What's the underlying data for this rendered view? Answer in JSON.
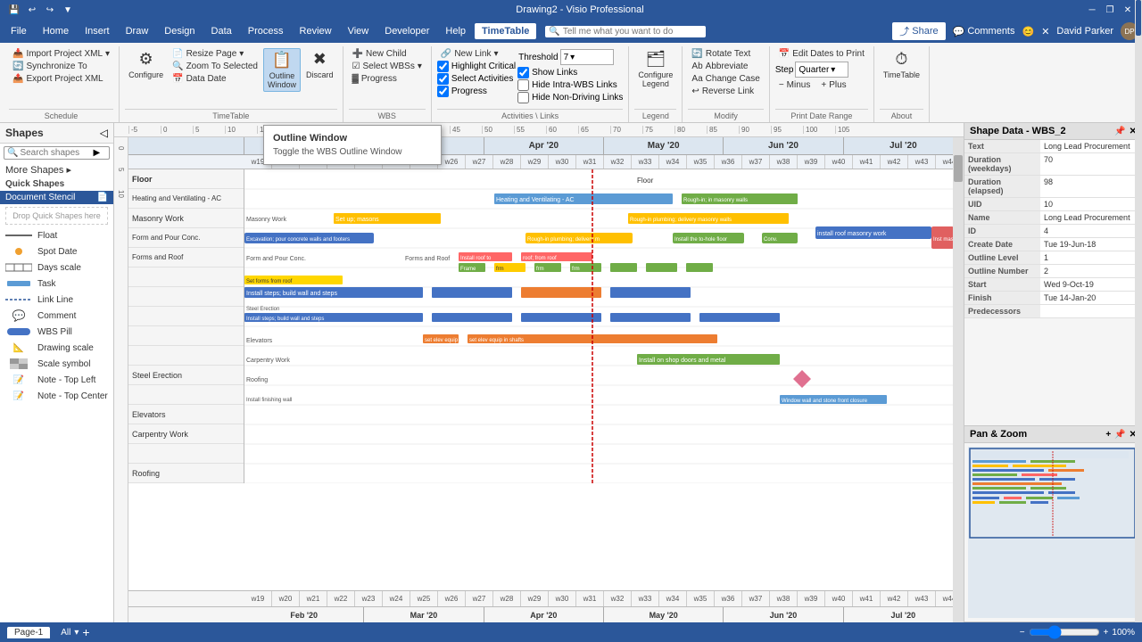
{
  "titlebar": {
    "title": "Drawing2 - Visio Professional",
    "quickaccess": [
      "save",
      "undo",
      "redo",
      "customize"
    ],
    "wincontrols": [
      "minimize",
      "restore",
      "close"
    ]
  },
  "menubar": {
    "items": [
      "File",
      "Home",
      "Insert",
      "Draw",
      "Design",
      "Data",
      "Process",
      "Review",
      "View",
      "Developer",
      "Help",
      "TimeTable"
    ],
    "active": "TimeTable",
    "search_placeholder": "Tell me what you want to do",
    "user": "David Parker",
    "share_label": "Share",
    "comments_label": "Comments"
  },
  "ribbon": {
    "groups": [
      {
        "name": "Schedule",
        "label": "Schedule",
        "items": [
          {
            "type": "btn",
            "label": "Import Project XML",
            "icon": "📥"
          },
          {
            "type": "btn",
            "label": "Synchronize To",
            "icon": "🔄"
          },
          {
            "type": "btn",
            "label": "Export Project XML",
            "icon": "📤"
          }
        ]
      },
      {
        "name": "TimeTable",
        "label": "TimeTable",
        "items": [
          {
            "type": "btn",
            "label": "Configure",
            "icon": "⚙"
          },
          {
            "type": "btn",
            "label": "Resize Page",
            "icon": "📄"
          },
          {
            "type": "btn",
            "label": "Zoom To Selected",
            "icon": "🔍"
          },
          {
            "type": "btn",
            "label": "Data Date",
            "icon": "📅"
          },
          {
            "type": "btn",
            "label": "Outline Window",
            "icon": "📋",
            "active": true
          },
          {
            "type": "btn",
            "label": "Discard",
            "icon": "✖"
          }
        ]
      },
      {
        "name": "WBS",
        "label": "WBS",
        "items": [
          {
            "type": "btn",
            "label": "New Child",
            "icon": "➕"
          },
          {
            "type": "btn",
            "label": "Select WBSs",
            "icon": "☑"
          },
          {
            "type": "btn",
            "label": "Progress",
            "icon": "📊"
          }
        ]
      },
      {
        "name": "ActivitiesLinks",
        "label": "Activities \\ Links",
        "items": [
          {
            "type": "check",
            "label": "Highlight Critical",
            "checked": true
          },
          {
            "type": "check",
            "label": "Show Links",
            "checked": true
          },
          {
            "type": "check",
            "label": "Select Activities",
            "checked": true
          },
          {
            "type": "check",
            "label": "Hide Intra-WBS Links",
            "checked": false
          },
          {
            "type": "check",
            "label": "Progress",
            "checked": true
          },
          {
            "type": "check",
            "label": "Hide Non-Driving Links",
            "checked": false
          },
          {
            "type": "btn",
            "label": "New Link",
            "icon": "🔗"
          },
          {
            "type": "combo",
            "label": "Threshold",
            "value": "7"
          }
        ]
      },
      {
        "name": "Legend",
        "label": "Legend",
        "items": [
          {
            "type": "btn",
            "label": "Configure Legend",
            "icon": "🗂"
          }
        ]
      },
      {
        "name": "Modify",
        "label": "Modify",
        "items": [
          {
            "type": "btn",
            "label": "Rotate Text",
            "icon": "🔄"
          },
          {
            "type": "btn",
            "label": "Abbreviate",
            "icon": "Ab"
          },
          {
            "type": "btn",
            "label": "Change Case",
            "icon": "Aa"
          },
          {
            "type": "btn",
            "label": "Reverse Link",
            "icon": "↩"
          }
        ]
      },
      {
        "name": "PrintDateRange",
        "label": "Print Date Range",
        "items": [
          {
            "type": "btn",
            "label": "Edit Dates to Print",
            "icon": "📅"
          },
          {
            "type": "combo",
            "label": "Step",
            "value": "Quarter"
          },
          {
            "type": "btn",
            "label": "Minus",
            "icon": "−"
          },
          {
            "type": "btn",
            "label": "Plus",
            "icon": "+"
          }
        ]
      },
      {
        "name": "About",
        "label": "About",
        "items": [
          {
            "type": "btn",
            "label": "TimeTable",
            "icon": "⏱"
          }
        ]
      }
    ]
  },
  "tooltip": {
    "title": "Outline Window",
    "description": "Toggle the WBS Outline Window"
  },
  "shapes_panel": {
    "title": "Shapes",
    "search_placeholder": "Search shapes",
    "more_shapes_label": "More Shapes",
    "quick_shapes_label": "Quick Shapes",
    "doc_stencil_label": "Document Stencil",
    "drop_zone_label": "Drop Quick Shapes here",
    "items": [
      {
        "name": "Float",
        "icon": "—"
      },
      {
        "name": "Spot Date",
        "icon": "●"
      },
      {
        "name": "Days scale",
        "icon": "≡"
      },
      {
        "name": "Task",
        "icon": "▬"
      },
      {
        "name": "Link Line",
        "icon": "—"
      },
      {
        "name": "Comment",
        "icon": "💬"
      },
      {
        "name": "WBS Pill",
        "icon": "▬"
      },
      {
        "name": "Drawing scale",
        "icon": "📐"
      },
      {
        "name": "Scale symbol",
        "icon": "▦"
      },
      {
        "name": "Note - Top Left",
        "icon": "📝"
      },
      {
        "name": "Note - Top Center",
        "icon": "📝"
      }
    ]
  },
  "gantt": {
    "months": [
      "Feb '20",
      "Mar '20",
      "Apr '20",
      "May '20",
      "Jun '20",
      "Jul '20"
    ],
    "weeks": [
      "w19",
      "w20",
      "w21",
      "w22",
      "w23",
      "w24",
      "w25",
      "w26",
      "w27",
      "w28",
      "w29",
      "w30",
      "w31",
      "w32",
      "w33",
      "w34",
      "w35",
      "w36",
      "w37",
      "w38",
      "w39",
      "w40",
      "w41",
      "w42",
      "w43",
      "w44"
    ],
    "rows": [
      {
        "label": "",
        "tasks": []
      },
      {
        "label": "Heating and Ventilating - AC",
        "tasks": [
          {
            "label": "Heating and Ventilating - AC",
            "color": "#5b9bd5",
            "start": 8,
            "width": 6
          }
        ]
      },
      {
        "label": "Masonry Work",
        "tasks": [
          {
            "label": "Masonry Work",
            "color": "#a9d18e",
            "start": 2,
            "width": 4
          },
          {
            "label": "",
            "color": "#ffc000",
            "start": 14,
            "width": 6
          }
        ]
      },
      {
        "label": "",
        "tasks": [
          {
            "label": "",
            "color": "#4472c4",
            "start": 0,
            "width": 5
          },
          {
            "label": "",
            "color": "#ed7d31",
            "start": 10,
            "width": 4
          },
          {
            "label": "",
            "color": "#70ad47",
            "start": 14,
            "width": 3
          },
          {
            "label": "",
            "color": "#4472c4",
            "start": 17,
            "width": 4
          }
        ]
      },
      {
        "label": "Form and Pour Conc.",
        "tasks": []
      },
      {
        "label": "",
        "tasks": [
          {
            "label": "",
            "color": "#ff0000",
            "start": 7,
            "width": 2
          },
          {
            "label": "",
            "color": "#ff0000",
            "start": 9,
            "width": 2
          }
        ]
      },
      {
        "label": "",
        "tasks": [
          {
            "label": "",
            "color": "#70ad47",
            "start": 7,
            "width": 2
          },
          {
            "label": "",
            "color": "#70ad47",
            "start": 9,
            "width": 2
          },
          {
            "label": "",
            "color": "#70ad47",
            "start": 11,
            "width": 2
          }
        ]
      },
      {
        "label": "Steel Erection",
        "tasks": [
          {
            "label": "",
            "color": "#4472c4",
            "start": 0,
            "width": 6
          },
          {
            "label": "",
            "color": "#4472c4",
            "start": 6,
            "width": 3
          },
          {
            "label": "",
            "color": "#4472c4",
            "start": 9,
            "width": 3
          },
          {
            "label": "",
            "color": "#4472c4",
            "start": 12,
            "width": 3
          }
        ]
      },
      {
        "label": "Elevators",
        "tasks": [
          {
            "label": "",
            "color": "#ed7d31",
            "start": 7,
            "width": 8
          }
        ]
      },
      {
        "label": "Carpentry Work",
        "tasks": [
          {
            "label": "",
            "color": "#70ad47",
            "start": 14,
            "width": 6
          }
        ]
      }
    ]
  },
  "shape_data": {
    "title": "Shape Data - WBS_2",
    "fields": [
      {
        "key": "Text",
        "value": "Long Lead Procurement"
      },
      {
        "key": "Duration (weekdays)",
        "value": "70"
      },
      {
        "key": "Duration (elapsed)",
        "value": "98"
      },
      {
        "key": "UID",
        "value": "10"
      },
      {
        "key": "Name",
        "value": "Long Lead Procurement"
      },
      {
        "key": "ID",
        "value": "4"
      },
      {
        "key": "Create Date",
        "value": "Tue 19-Jun-18"
      },
      {
        "key": "Outline Level",
        "value": "1"
      },
      {
        "key": "Outline Number",
        "value": "2"
      },
      {
        "key": "Start",
        "value": "Wed 9-Oct-19"
      },
      {
        "key": "Finish",
        "value": "Tue 14-Jan-20"
      },
      {
        "key": "Predecessors",
        "value": ""
      }
    ]
  },
  "pan_zoom": {
    "title": "Pan & Zoom"
  },
  "statusbar": {
    "page_label": "Page-1",
    "all_label": "All",
    "add_page_icon": "+"
  }
}
